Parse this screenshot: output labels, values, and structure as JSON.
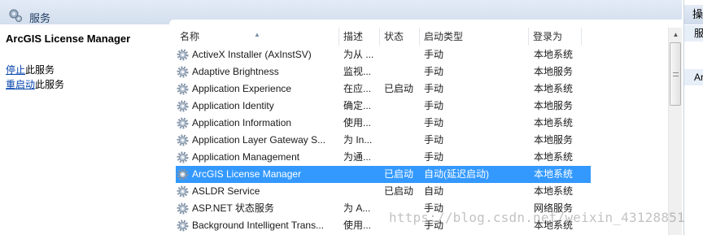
{
  "window": {
    "title": "服务"
  },
  "left_pane": {
    "service_name": "ArcGIS License Manager",
    "actions": [
      {
        "link": "停止",
        "rest": "此服务"
      },
      {
        "link": "重启动",
        "rest": "此服务"
      }
    ]
  },
  "columns": [
    "名称",
    "描述",
    "状态",
    "启动类型",
    "登录为"
  ],
  "services": [
    {
      "name": "ActiveX Installer (AxInstSV)",
      "desc": "为从 ...",
      "status": "",
      "startup": "手动",
      "logon": "本地系统"
    },
    {
      "name": "Adaptive Brightness",
      "desc": "监视...",
      "status": "",
      "startup": "手动",
      "logon": "本地服务"
    },
    {
      "name": "Application Experience",
      "desc": "在应...",
      "status": "已启动",
      "startup": "手动",
      "logon": "本地系统"
    },
    {
      "name": "Application Identity",
      "desc": "确定...",
      "status": "",
      "startup": "手动",
      "logon": "本地服务"
    },
    {
      "name": "Application Information",
      "desc": "使用...",
      "status": "",
      "startup": "手动",
      "logon": "本地系统"
    },
    {
      "name": "Application Layer Gateway S...",
      "desc": "为 In...",
      "status": "",
      "startup": "手动",
      "logon": "本地服务"
    },
    {
      "name": "Application Management",
      "desc": "为通...",
      "status": "",
      "startup": "手动",
      "logon": "本地系统"
    },
    {
      "name": "ArcGIS License Manager",
      "desc": "",
      "status": "已启动",
      "startup": "自动(延迟启动)",
      "logon": "本地系统",
      "selected": true
    },
    {
      "name": "ASLDR Service",
      "desc": "",
      "status": "已启动",
      "startup": "自动",
      "logon": "本地系统"
    },
    {
      "name": "ASP.NET 状态服务",
      "desc": "为 A...",
      "status": "",
      "startup": "手动",
      "logon": "网络服务"
    },
    {
      "name": "Background Intelligent Trans...",
      "desc": "使用...",
      "status": "",
      "startup": "手动",
      "logon": "本地系统"
    }
  ],
  "right_pane": {
    "title": "操",
    "sections": [
      "服",
      "Ar"
    ]
  },
  "watermark": "https://blog.csdn.net/weixin_43128851",
  "icons": {
    "title": "services-icon",
    "row": "gear-icon"
  },
  "colors": {
    "selection": "#3399ff",
    "link": "#0645ad",
    "title_bar": "#d6e1ef"
  }
}
